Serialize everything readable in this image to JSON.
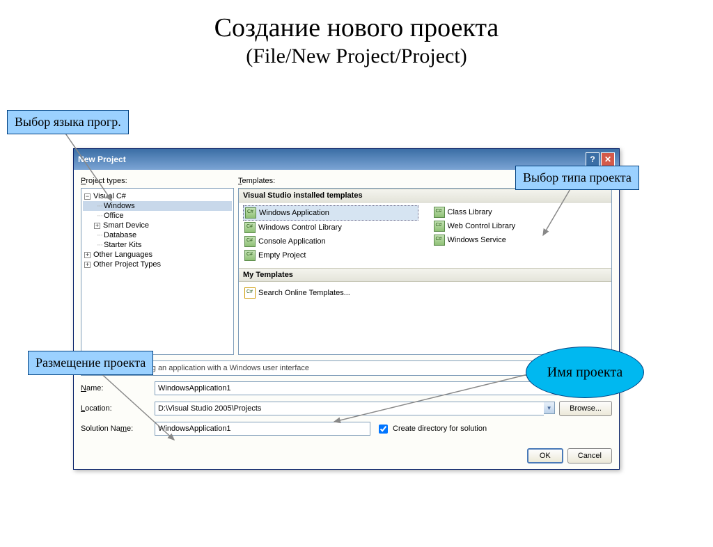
{
  "slide": {
    "title": "Создание нового проекта",
    "subtitle": "(File/New Project/Project)"
  },
  "annotations": {
    "lang_select": "Выбор языка прогр.",
    "project_type": "Выбор типа проекта",
    "placement": "Размещение проекта",
    "project_name": "Имя  проекта"
  },
  "dialog": {
    "title": "New Project",
    "project_types_label": "Project types:",
    "templates_label": "Templates:",
    "tree": {
      "root1": "Visual C#",
      "child_windows": "Windows",
      "child_office": "Office",
      "child_smart": "Smart Device",
      "child_db": "Database",
      "child_kits": "Starter Kits",
      "root2": "Other Languages",
      "root3": "Other Project Types"
    },
    "section_installed": "Visual Studio installed templates",
    "section_my": "My Templates",
    "templates_left": [
      "Windows Application",
      "Windows Control Library",
      "Console Application",
      "Empty Project"
    ],
    "templates_right": [
      "Class Library",
      "Web Control Library",
      "Windows Service"
    ],
    "search_online": "Search Online Templates...",
    "description": "A project for creating an application with a Windows user interface",
    "name_label": "Name:",
    "name_value": "WindowsApplication1",
    "location_label": "Location:",
    "location_value": "D:\\Visual Studio 2005\\Projects",
    "solution_label": "Solution Name:",
    "solution_value": "WindowsApplication1",
    "browse": "Browse...",
    "create_dir": "Create directory for solution",
    "ok": "OK",
    "cancel": "Cancel"
  }
}
